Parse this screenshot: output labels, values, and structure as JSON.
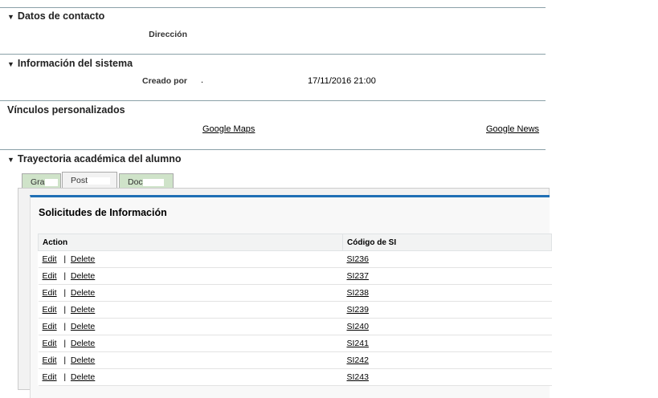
{
  "sections": {
    "contact": {
      "title": "Datos de contacto",
      "address_label": "Dirección"
    },
    "system": {
      "title": "Información del sistema",
      "created_by_label": "Creado por",
      "created_by_value": ".",
      "created_date": "17/11/2016 21:00"
    },
    "links": {
      "title": "Vínculos personalizados",
      "google_maps": "Google Maps",
      "google_news": "Google News"
    },
    "academic": {
      "title": "Trayectoria académica del alumno",
      "tabs": [
        {
          "label": "Gra"
        },
        {
          "label": "Post"
        },
        {
          "label": "Doc"
        }
      ]
    }
  },
  "related_list": {
    "title": "Solicitudes de Información",
    "columns": [
      "Action",
      "Código de SI"
    ],
    "edit_label": "Edit",
    "delete_label": "Delete",
    "rows": [
      "SI236",
      "SI237",
      "SI238",
      "SI239",
      "SI240",
      "SI241",
      "SI242",
      "SI243"
    ]
  },
  "icons": {
    "collapse": "triangle-down-icon"
  }
}
